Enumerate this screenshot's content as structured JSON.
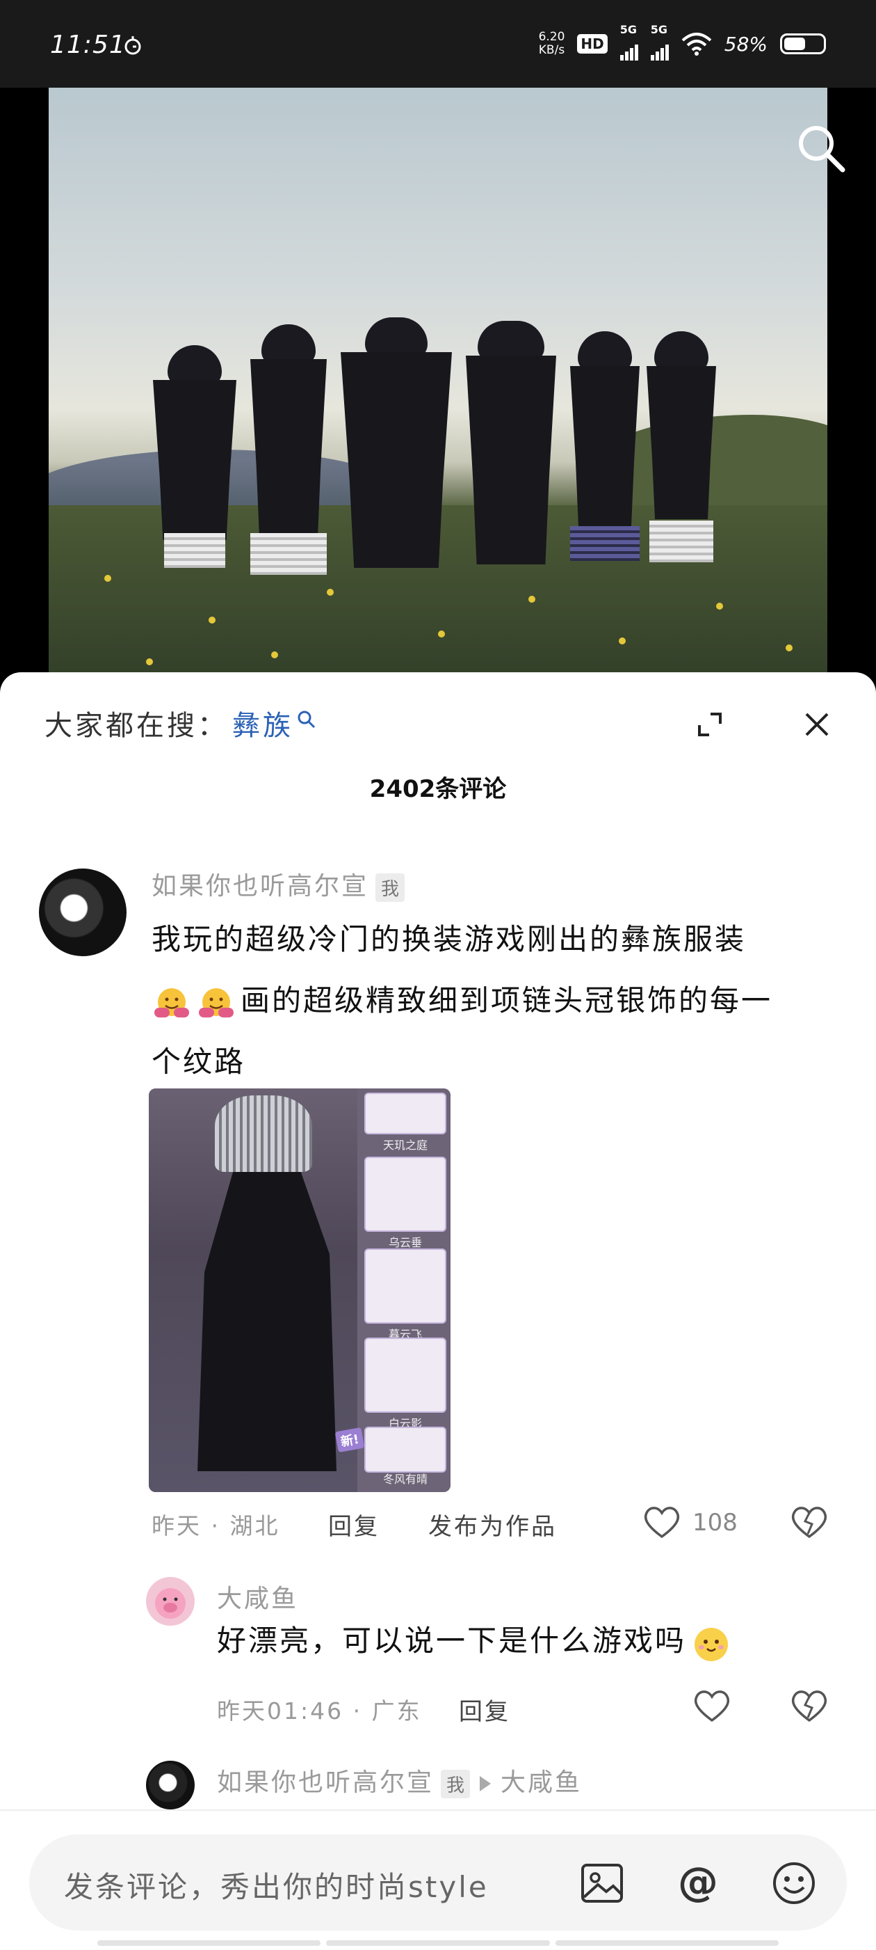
{
  "status_bar": {
    "time": "11:51",
    "net_speed_value": "6.20",
    "net_speed_unit": "KB/s",
    "hd_label": "HD",
    "signal1_label": "5G",
    "signal2_label": "5G",
    "battery_percent": "58%"
  },
  "video": {
    "search_icon": "search-icon"
  },
  "sheet": {
    "hot_search_label": "大家都在搜：",
    "hot_search_term": "彝族",
    "comment_count": "2402条评论"
  },
  "comment": {
    "username": "如果你也听高尔宣",
    "me_badge": "我",
    "text_line1": "我玩的超级冷门的换装游戏刚出的彝族服装",
    "text_line2": "画的超级精致细到项链头冠银饰的每一",
    "text_line3": "个纹路",
    "image_items": [
      "天玑之庭",
      "乌云垂",
      "暮云飞",
      "白云影",
      "冬风有晴"
    ],
    "image_new_badge": "新!",
    "time_location": "昨天 · 湖北",
    "reply_label": "回复",
    "publish_label": "发布为作品",
    "like_count": "108"
  },
  "reply": {
    "username": "大咸鱼",
    "text": "好漂亮，可以说一下是什么游戏吗",
    "time_location": "昨天01:46 · 广东",
    "reply_label": "回复"
  },
  "reply2": {
    "username": "如果你也听高尔宣",
    "me_badge": "我",
    "target_user": "大咸鱼"
  },
  "input_bar": {
    "placeholder": "发条评论，秀出你的时尚style"
  },
  "colors": {
    "accent_link": "#2b62b5",
    "meta_gray": "#999999"
  }
}
